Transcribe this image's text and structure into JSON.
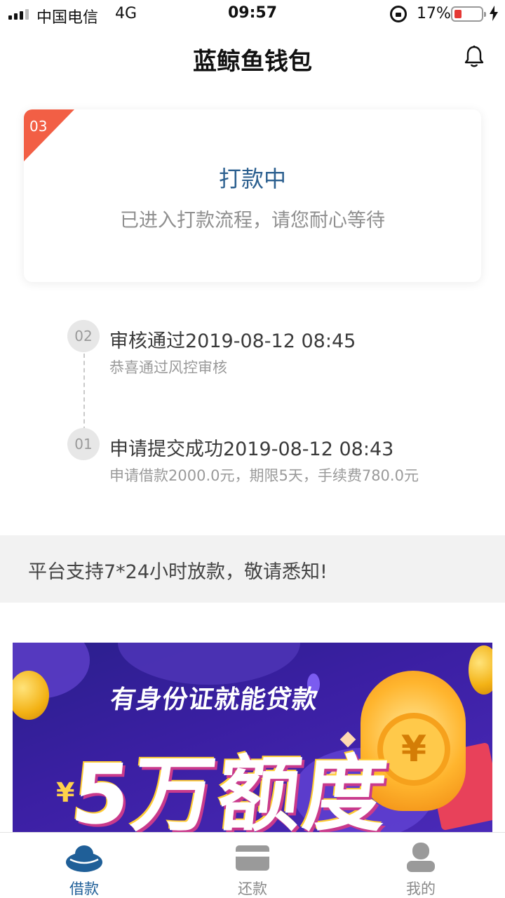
{
  "status_bar": {
    "carrier": "中国电信",
    "network": "4G",
    "time": "09:57",
    "battery_percent": "17%",
    "battery_level": 0.17,
    "battery_color": "#e53935"
  },
  "header": {
    "title": "蓝鲸鱼钱包",
    "bell_icon": "bell-icon"
  },
  "status_card": {
    "step": "03",
    "title": "打款中",
    "subtitle": "已进入打款流程，请您耐心等待",
    "ribbon_color": "#f25f45"
  },
  "timeline": {
    "items": [
      {
        "step": "02",
        "title": "审核通过2019-08-12 08:45",
        "desc": "恭喜通过风控审核"
      },
      {
        "step": "01",
        "title": "申请提交成功2019-08-12 08:43",
        "desc": "申请借款2000.0元，期限5天，手续费780.0元"
      }
    ]
  },
  "notice": {
    "text": "平台支持7*24小时放款，敬请悉知!"
  },
  "banner": {
    "headline": "有身份证就能贷款",
    "amount_text": "5万额度",
    "currency": "¥"
  },
  "tab_bar": {
    "accent_color": "#1f5f98",
    "tabs": [
      {
        "label": "借款",
        "icon": "ingot-icon",
        "active": true
      },
      {
        "label": "还款",
        "icon": "card-icon",
        "active": false
      },
      {
        "label": "我的",
        "icon": "user-icon",
        "active": false
      }
    ]
  }
}
